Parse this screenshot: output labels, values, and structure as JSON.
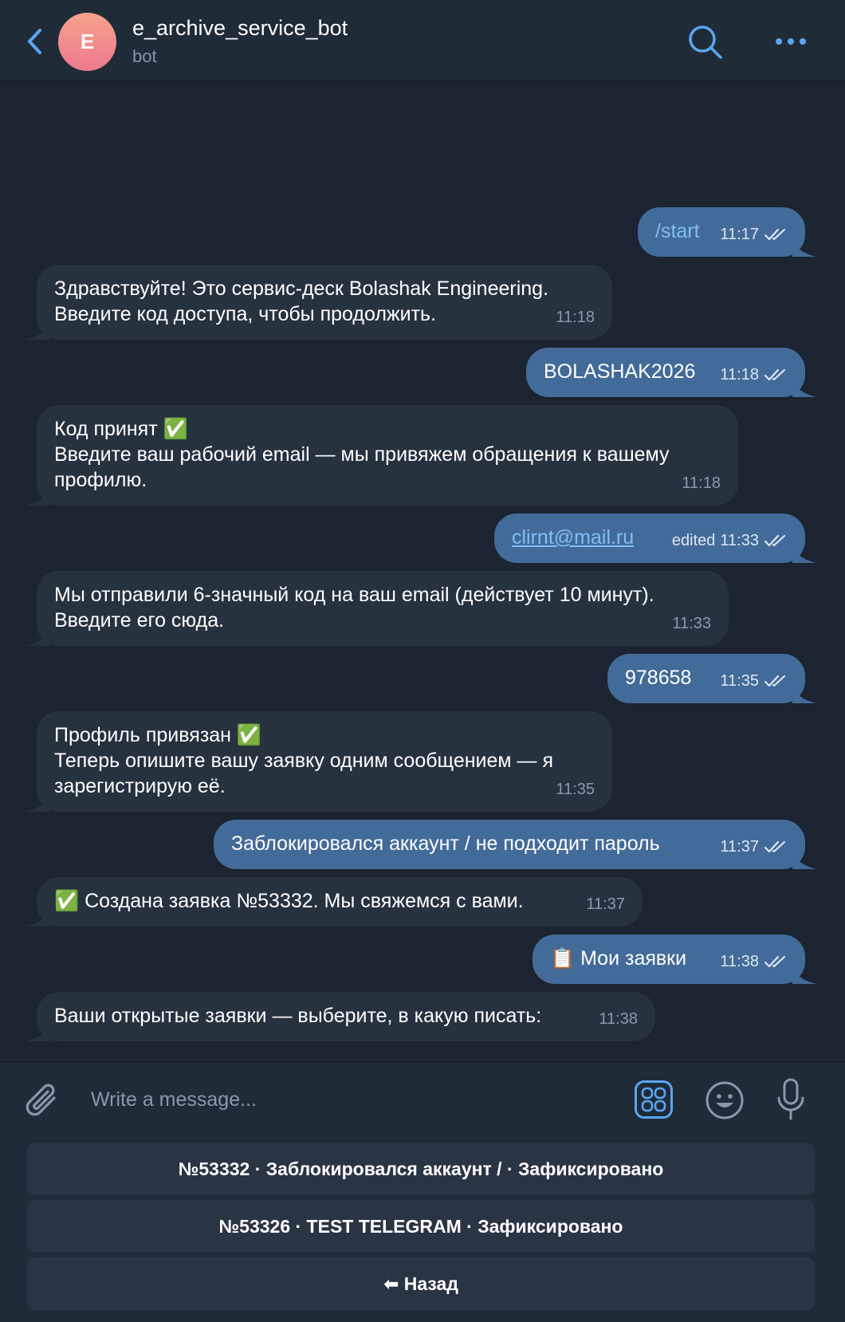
{
  "header": {
    "title": "e_archive_service_bot",
    "subtitle": "bot",
    "avatar_letter": "E",
    "icons": {
      "back": "chevron-left-icon",
      "search": "search-icon",
      "more": "more-dots-icon"
    }
  },
  "messages": [
    {
      "dir": "out",
      "text": "/start",
      "time": "11:17",
      "read": true
    },
    {
      "dir": "in",
      "lines": [
        "Здравствуйте! Это сервис-деск Bolashak Engineering.",
        "Введите код доступа, чтобы продолжить."
      ],
      "time": "11:18"
    },
    {
      "dir": "out",
      "text": "BOLASHAK2026",
      "time": "11:18",
      "read": true
    },
    {
      "dir": "in",
      "lines": [
        "Код принят ✅",
        "Введите ваш рабочий email — мы привяжем обращения к вашему",
        "профилю."
      ],
      "time": "11:18"
    },
    {
      "dir": "out",
      "text": "clirnt@mail.ru",
      "edited": "edited",
      "time": "11:33",
      "read": true
    },
    {
      "dir": "in",
      "lines": [
        "Мы отправили 6-значный код на ваш email (действует 10 минут).",
        "Введите его сюда."
      ],
      "time": "11:33"
    },
    {
      "dir": "out",
      "text": "978658",
      "time": "11:35",
      "read": true
    },
    {
      "dir": "in",
      "lines": [
        "Профиль привязан ✅",
        "Теперь опишите вашу заявку одним сообщением — я",
        "зарегистрирую её."
      ],
      "time": "11:35"
    },
    {
      "dir": "out",
      "text": "Заблокировался аккаунт / не подходит пароль",
      "time": "11:37",
      "read": true
    },
    {
      "dir": "in",
      "text": "✅ Создана заявка №53332. Мы свяжемся с вами.",
      "time": "11:37"
    },
    {
      "dir": "out",
      "text": "📋 Мои заявки",
      "time": "11:38",
      "read": true
    },
    {
      "dir": "in",
      "text": "Ваши открытые заявки — выберите, в какую писать:",
      "time": "11:38"
    }
  ],
  "composer": {
    "placeholder": "Write a message...",
    "icons": {
      "attach": "paperclip-icon",
      "keyboard": "bot-keyboard-icon",
      "emoji": "emoji-icon",
      "mic": "microphone-icon"
    }
  },
  "keyboard": {
    "buttons": [
      "№53332 · Заблокировался аккаунт / · Зафиксировано",
      "№53326 · TEST TELEGRAM · Зафиксировано",
      "⬅ Назад"
    ]
  },
  "colors": {
    "background": "#1b2430",
    "header": "#202b38",
    "incoming_bubble": "#27323f",
    "outgoing_bubble": "#436b99",
    "accent": "#5aa6f2"
  }
}
